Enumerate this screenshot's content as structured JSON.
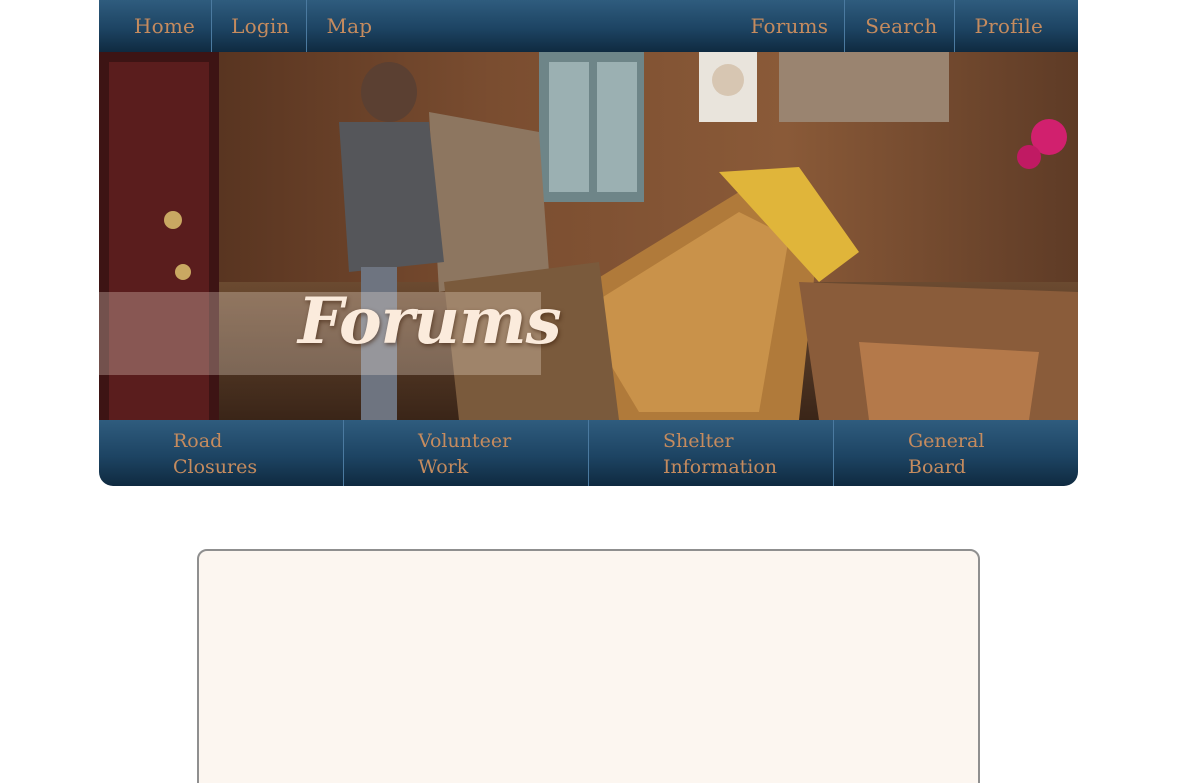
{
  "topnav": {
    "left": [
      {
        "label": "Home"
      },
      {
        "label": "Login"
      },
      {
        "label": "Map"
      }
    ],
    "right": [
      {
        "label": "Forums"
      },
      {
        "label": "Search"
      },
      {
        "label": "Profile"
      }
    ]
  },
  "hero": {
    "title": "Forums"
  },
  "subnav": [
    {
      "line1": "Road",
      "line2": "Closures"
    },
    {
      "line1": "Volunteer",
      "line2": "Work"
    },
    {
      "line1": "Shelter",
      "line2": "Information"
    },
    {
      "line1": "General",
      "line2": "Board"
    }
  ],
  "colors": {
    "nav_bg": "#1d4463",
    "nav_text": "#c58b5e",
    "content_bg": "#fcf6f0"
  }
}
